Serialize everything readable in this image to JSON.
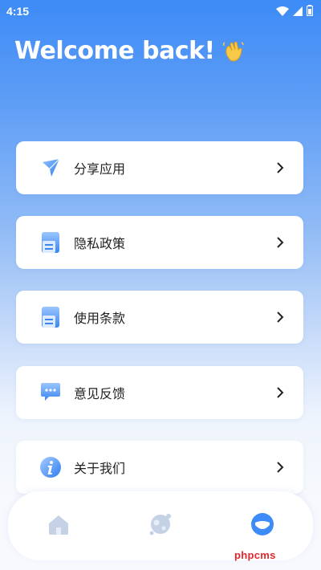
{
  "status_bar": {
    "time": "4:15",
    "icons": [
      "wifi-icon",
      "signal-icon",
      "battery-icon"
    ]
  },
  "header": {
    "title": "Welcome back!",
    "emoji_icon": "clapping-hands-icon"
  },
  "menu": {
    "items": [
      {
        "label": "分享应用",
        "icon": "send-icon"
      },
      {
        "label": "隐私政策",
        "icon": "document-icon"
      },
      {
        "label": "使用条款",
        "icon": "document-icon"
      },
      {
        "label": "意见反馈",
        "icon": "chat-bubble-icon"
      },
      {
        "label": "关于我们",
        "icon": "info-icon"
      }
    ],
    "chevron_icon": "chevron-right-icon"
  },
  "tabbar": {
    "tabs": [
      {
        "icon": "home-icon",
        "active": false
      },
      {
        "icon": "planet-icon",
        "active": false
      },
      {
        "icon": "profile-icon",
        "active": true
      }
    ],
    "active_color": "#3d8bf7",
    "inactive_color": "#c5d2e6"
  },
  "watermark": {
    "text": "phpcms",
    "color": "#e8262c"
  },
  "colors": {
    "accent": "#3d8bf7",
    "card": "#ffffff",
    "text": "#222222"
  }
}
